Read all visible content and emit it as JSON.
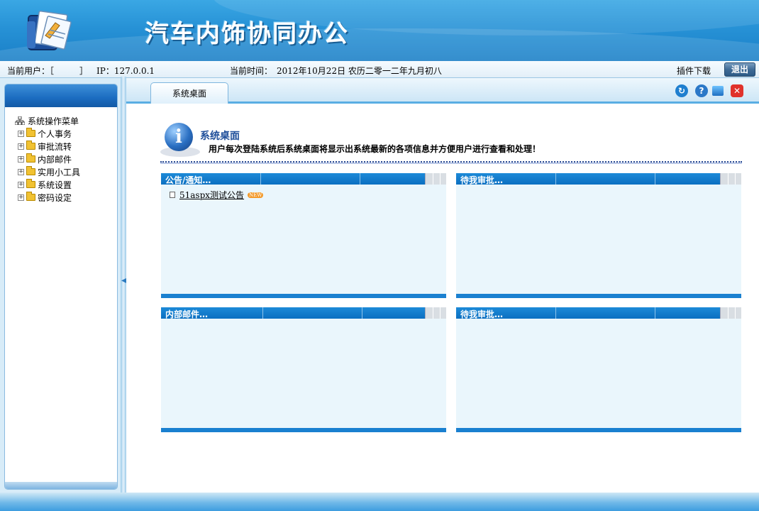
{
  "header": {
    "title": "汽车内饰协同办公"
  },
  "infobar": {
    "current_user": "当前用户：［　　　］",
    "ip": "IP：127.0.0.1",
    "current_time": "当前时间：　2012年10月22日 农历二零一二年九月初八",
    "plugin_download": "插件下载",
    "exit_label": "退出"
  },
  "sidebar": {
    "root_label": "系统操作菜单",
    "items": [
      {
        "label": "个人事务"
      },
      {
        "label": "审批流转"
      },
      {
        "label": "内部邮件"
      },
      {
        "label": "实用小工具"
      },
      {
        "label": "系统设置"
      },
      {
        "label": "密码设定"
      }
    ]
  },
  "tabs": [
    {
      "label": "系统桌面"
    }
  ],
  "banner": {
    "title": "系统桌面",
    "description": "用户每次登陆系统后系统桌面将显示出系统最新的各项信息并方便用户进行查看和处理！"
  },
  "panels": [
    {
      "title": "公告/通知…",
      "items": [
        {
          "text": "51aspx测试公告",
          "badge": "NEW"
        }
      ]
    },
    {
      "title": "待我审批…",
      "items": []
    },
    {
      "title": "内部邮件…",
      "items": []
    },
    {
      "title": "待我审批…",
      "items": []
    }
  ],
  "colors": {
    "header_blue": "#2792d6",
    "panel_head_blue": "#0b6fc1",
    "panel_body": "#eaf6fc",
    "exit_button": "#3f6b96"
  }
}
